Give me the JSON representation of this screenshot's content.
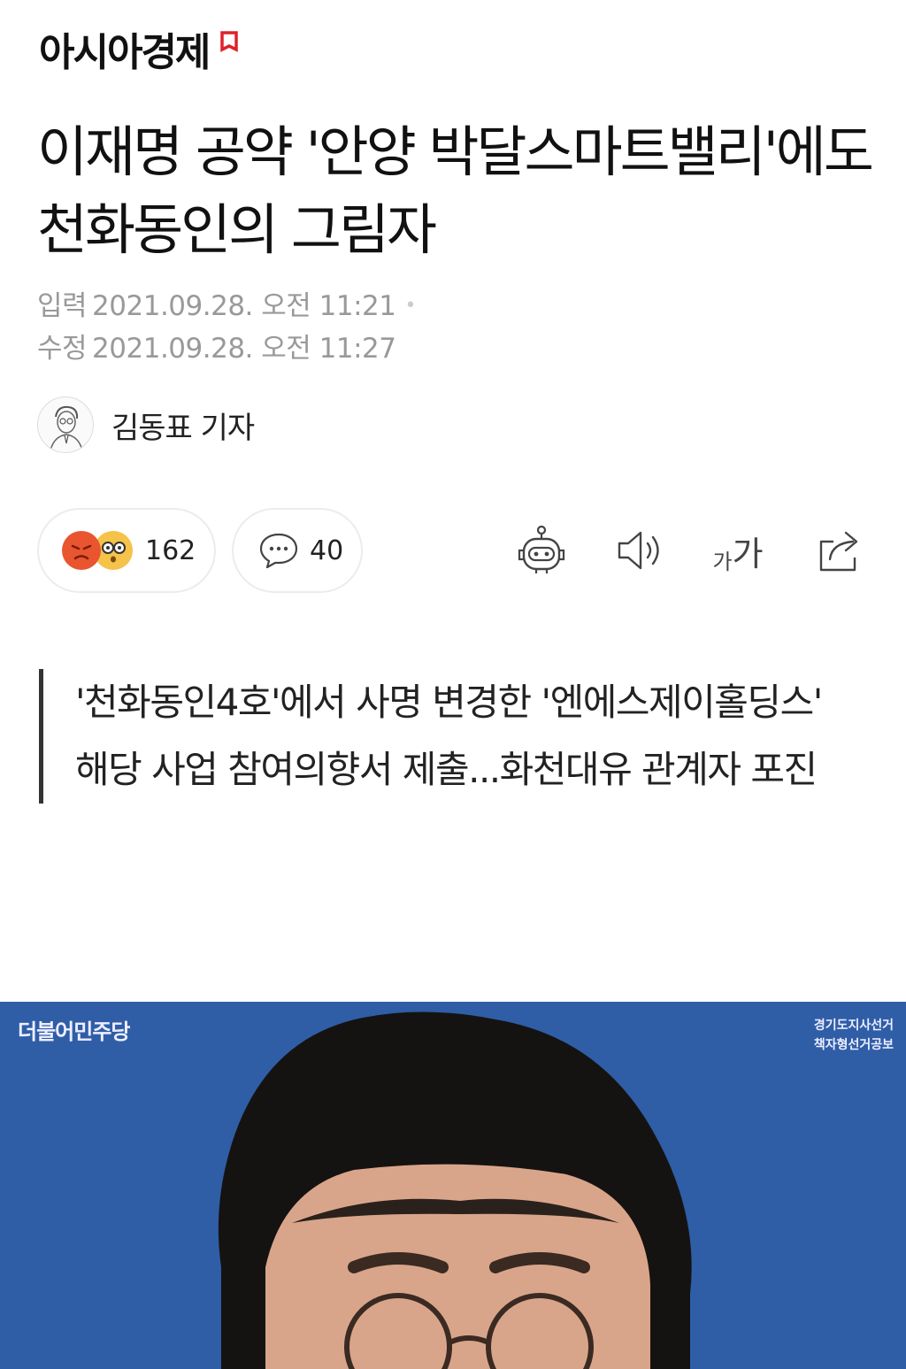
{
  "header": {
    "brand": "아시아경제",
    "brand_color": "#e0202a"
  },
  "article": {
    "headline": "이재명 공약 '안양 박달스마트밸리'에도 천화동인의 그림자",
    "published_label": "입력",
    "published_value": "2021.09.28. 오전 11:21",
    "modified_label": "수정",
    "modified_value": "2021.09.28. 오전 11:27",
    "author": "김동표 기자"
  },
  "actions": {
    "reaction_count": "162",
    "comment_count": "40",
    "font_small": "가",
    "font_large": "가",
    "icons": [
      "angry-emoji-icon",
      "surprised-emoji-icon",
      "comment-bubble-icon",
      "robot-summary-icon",
      "speaker-icon",
      "font-size-icon",
      "share-icon"
    ]
  },
  "subtitle": {
    "line1": "'천화동인4호'에서 사명 변경한 '엔에스제이홀딩스'",
    "line2": "해당 사업 참여의향서 제출...화천대유 관계자 포진"
  },
  "photo": {
    "party": "더불어민주당",
    "notice_line1": "경기도지사선거",
    "notice_line2": "책자형선거공보",
    "background": "#2f5ea7"
  }
}
